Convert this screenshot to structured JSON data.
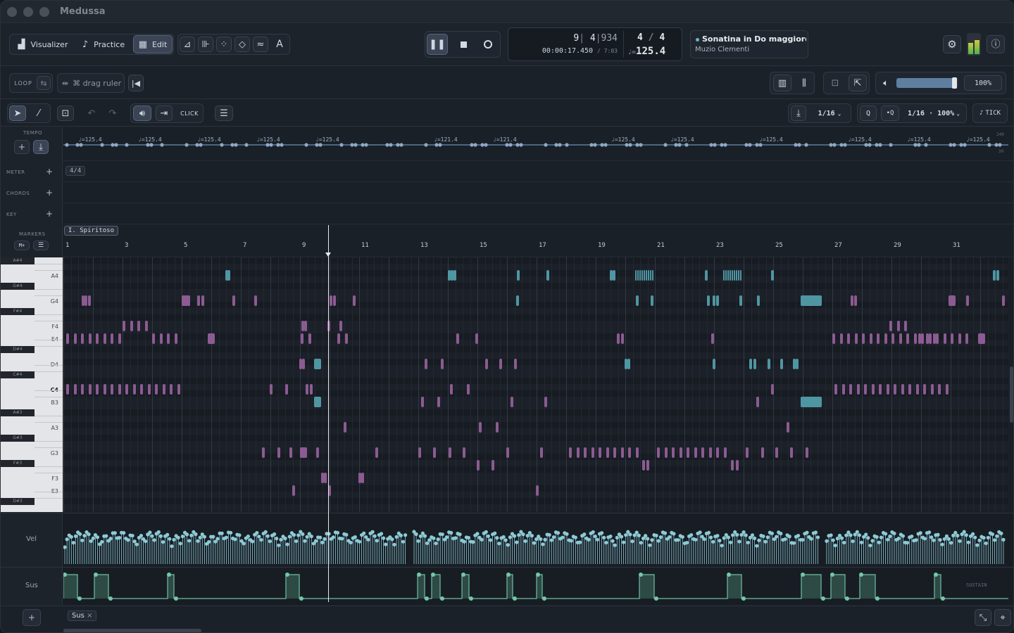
{
  "app": {
    "title": "Medussa"
  },
  "toolbar": {
    "visualizer": "Visualizer",
    "practice": "Practice",
    "edit": "Edit",
    "text_tool": "A"
  },
  "transport": {
    "bar": "9",
    "beat": "4",
    "tick": "934",
    "time": "00:00:17.450",
    "duration": "/ 7:03",
    "sig_num": "4",
    "sig_den": "4",
    "tempo_prefix": "♩=",
    "tempo": "125.4"
  },
  "song": {
    "title": "Sonatina in Do maggiore, C",
    "composer": "Muzio Clementi"
  },
  "row2": {
    "loop": "LOOP",
    "drag_ruler": "⌘ drag ruler",
    "volume": "100%",
    "volume_level": 0.97
  },
  "row3": {
    "click": "CLICK",
    "grid": "1/16",
    "q": "Q",
    "q2": "•Q",
    "quant": "1/16",
    "dot": "·",
    "strength": "100%",
    "tick": "TICK"
  },
  "lanes": {
    "tempo": "TEMPO",
    "meter": "METER",
    "chords": "CHORDS",
    "key": "KEY",
    "markers": "MARKERS",
    "markers_add": "M+",
    "meter_value": "4/4",
    "marker_name": "I. Spiritoso",
    "tempo_max": "240",
    "tempo_min": "30",
    "tempo_labels": [
      "♩=125.4",
      "♩=125.4",
      "♩=125.4",
      "♩=125.4",
      "♩=125.4",
      "♩=121.4",
      "♩=121.4",
      "♩=125.4",
      "♩=125.4",
      "♩=125.4",
      "♩=125.4",
      "♩=125.4",
      "♩=125.4"
    ]
  },
  "ruler": [
    "1",
    "3",
    "5",
    "7",
    "9",
    "11",
    "13",
    "15",
    "17",
    "19",
    "21",
    "23",
    "25",
    "27",
    "29",
    "31"
  ],
  "keyboard": {
    "white": [
      "A4",
      "G4",
      "F4",
      "E4",
      "D4",
      "C4",
      "B3",
      "A3",
      "G3",
      "F3",
      "E3"
    ],
    "black": [
      "A#4",
      "G#4",
      "F#4",
      "D#4",
      "C#4",
      "A#3",
      "G#3",
      "F#3",
      "D#3"
    ]
  },
  "vel": {
    "label": "Vel"
  },
  "sus": {
    "label": "Sus",
    "lane_tag": "SUSTAIN"
  },
  "bottom": {
    "chip": "Sus",
    "chip_close": "×",
    "add": "+"
  },
  "colors": {
    "accent": "#6fb6c4",
    "note_purple": "#8c5b92",
    "note_teal": "#4f96a3",
    "bg": "#1b212a"
  }
}
